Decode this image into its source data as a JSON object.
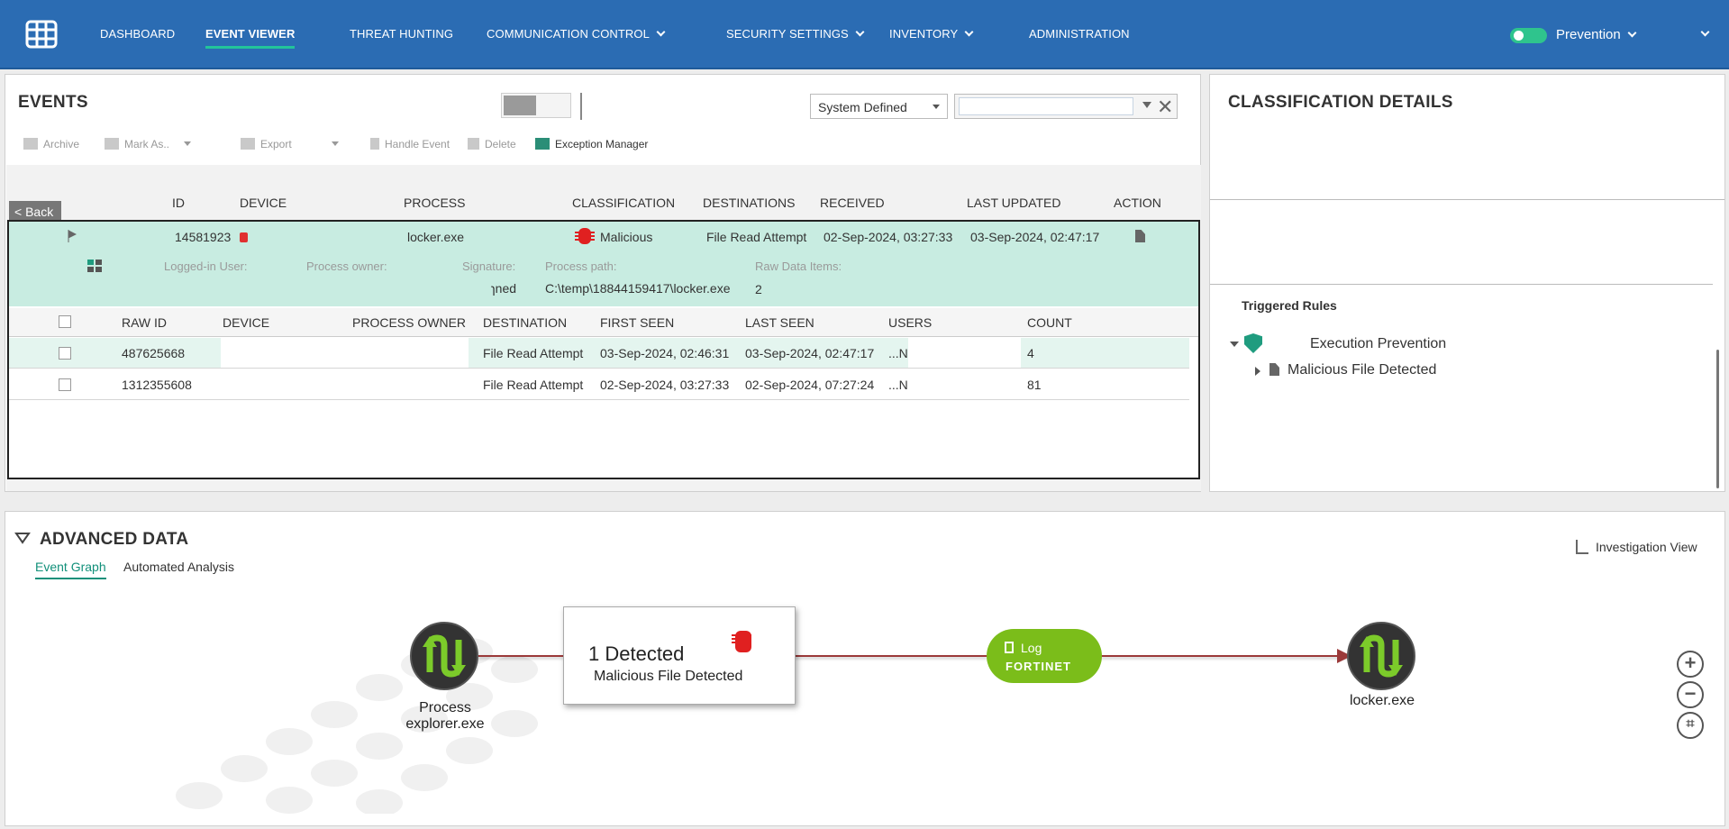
{
  "nav": {
    "items": [
      {
        "label": "DASHBOARD"
      },
      {
        "label": "EVENT VIEWER"
      },
      {
        "label": "THREAT HUNTING"
      },
      {
        "label": "COMMUNICATION CONTROL"
      },
      {
        "label": "SECURITY SETTINGS"
      },
      {
        "label": "INVENTORY"
      },
      {
        "label": "ADMINISTRATION"
      }
    ],
    "mode": "Prevention"
  },
  "events": {
    "title": "EVENTS",
    "filter_select": "System Defined",
    "toolbar": {
      "archive": "Archive",
      "mark_as": "Mark As..",
      "export": "Export",
      "handle_event": "Handle Event",
      "delete": "Delete",
      "exception_manager": "Exception Manager"
    },
    "back": "< Back",
    "columns": {
      "id": "ID",
      "device": "DEVICE",
      "process": "PROCESS",
      "classification": "CLASSIFICATION",
      "destinations": "DESTINATIONS",
      "received": "RECEIVED",
      "last_updated": "LAST UPDATED",
      "action": "ACTION"
    },
    "selected": {
      "id": "14581923",
      "process": "locker.exe",
      "classification": "Malicious",
      "destinations": "File Read Attempt",
      "received": "02-Sep-2024, 03:27:33",
      "last_updated": "03-Sep-2024, 02:47:17"
    },
    "detail": {
      "logged_in_user_label": "Logged-in User:",
      "process_owner_label": "Process owner:",
      "signature_label": "Signature:",
      "signature_value": "ɿned",
      "process_path_label": "Process path:",
      "process_path_value": "C:\\temp\\18844159417\\locker.exe",
      "raw_items_label": "Raw Data Items:",
      "raw_items_value": "2"
    },
    "raw_columns": {
      "raw_id": "RAW ID",
      "device": "DEVICE",
      "process_owner": "PROCESS OWNER",
      "destination": "DESTINATION",
      "first_seen": "FIRST SEEN",
      "last_seen": "LAST SEEN",
      "users": "USERS",
      "count": "COUNT"
    },
    "raw_rows": [
      {
        "raw_id": "487625668",
        "destination": "File Read Attempt",
        "first_seen": "03-Sep-2024, 02:46:31",
        "last_seen": "03-Sep-2024, 02:47:17",
        "users": "...N",
        "count": "4"
      },
      {
        "raw_id": "1312355608",
        "destination": "File Read Attempt",
        "first_seen": "02-Sep-2024, 03:27:33",
        "last_seen": "02-Sep-2024, 07:27:24",
        "users": "...N",
        "count": "81"
      }
    ]
  },
  "classification": {
    "title": "CLASSIFICATION DETAILS",
    "triggered_rules": "Triggered Rules",
    "policy": "Execution Prevention",
    "rule": "Malicious File Detected"
  },
  "advanced": {
    "title": "ADVANCED DATA",
    "tabs": [
      "Event Graph",
      "Automated Analysis"
    ],
    "investigation_view": "Investigation View",
    "graph": {
      "process_label": "Process",
      "process_name": "explorer.exe",
      "detected": "1 Detected",
      "detected_rule": "Malicious File Detected",
      "log_label": "Log",
      "brand": "FORTINET",
      "target_name": "locker.exe"
    }
  },
  "colors": {
    "nav_bg": "#2b6cb3",
    "accent": "#22c49a",
    "selected_row": "#c8ece1",
    "malicious": "#e02020",
    "log_green": "#7bbd1a"
  }
}
